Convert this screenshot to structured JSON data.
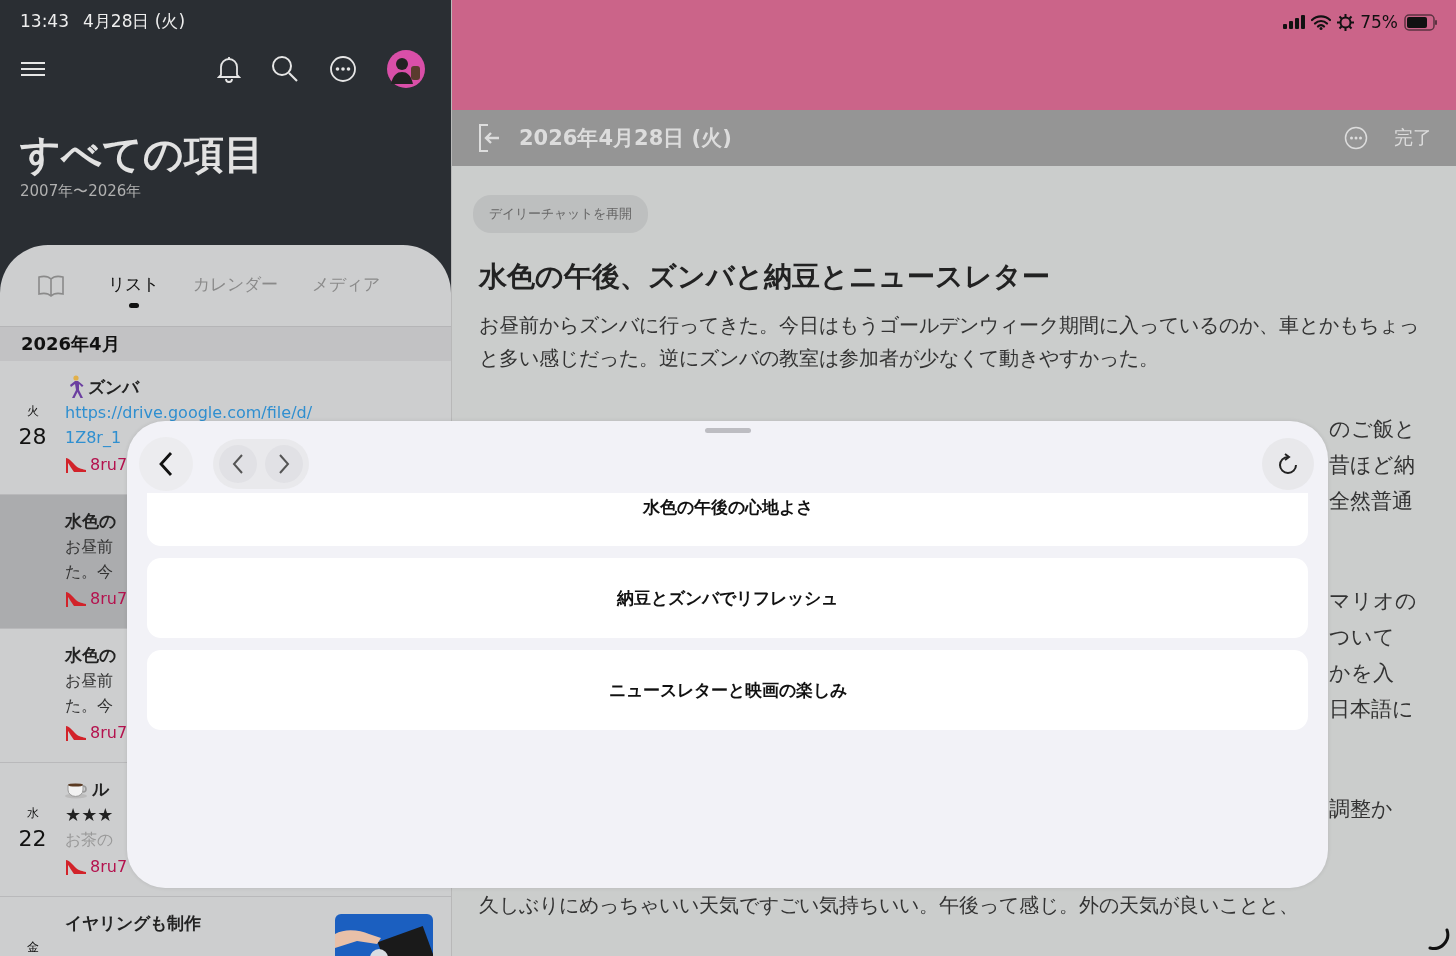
{
  "status_bar": {
    "time": "13:43",
    "date": "4月28日 (火)",
    "battery": "75%"
  },
  "sidebar": {
    "title": "すべての項目",
    "subtitle": "2007年〜2026年",
    "tabs": [
      {
        "label": "リスト",
        "selected": true
      },
      {
        "label": "カレンダー",
        "selected": false
      },
      {
        "label": "メディア",
        "selected": false
      }
    ],
    "month": "2026年4月",
    "entries": [
      {
        "weekday": "火",
        "day": "28",
        "selected": false,
        "title": "ズンバ",
        "lines": [
          {
            "kind": "link",
            "text": "https://drive.google.com/file/d/"
          },
          {
            "kind": "link",
            "text": "1Z8r_1"
          }
        ],
        "tag": "8ru7"
      },
      {
        "selected": true,
        "title": "水色の",
        "lines": [
          {
            "kind": "text",
            "text": "お昼前"
          },
          {
            "kind": "text",
            "text": "た。今"
          }
        ],
        "tag": "8ru7"
      },
      {
        "selected": false,
        "title": "水色の",
        "lines": [
          {
            "kind": "text",
            "text": "お昼前"
          },
          {
            "kind": "text",
            "text": "た。今"
          }
        ],
        "tag": "8ru7"
      },
      {
        "weekday": "水",
        "day": "22",
        "selected": false,
        "title": "ル",
        "lines": [
          {
            "kind": "stars",
            "text": "★★★"
          },
          {
            "kind": "muted",
            "text": "お茶の"
          }
        ],
        "tag": "8ru7"
      },
      {
        "weekday": "金",
        "selected": false,
        "title": "イヤリングも制作"
      }
    ]
  },
  "detail": {
    "date": "2026年4月28日 (火)",
    "done": "完了",
    "chip": "デイリーチャットを再開",
    "title": "水色の午後、ズンバと納豆とニュースレター",
    "paragraph": "お昼前からズンバに行ってきた。今日はもうゴールデンウィーク期間に入っているのか、車とかもちょっと多い感じだった。逆にズンバの教室は参加者が少なくて動きやすかった。",
    "partly_covered_lines": [
      [
        "のご飯と",
        "昔ほど納",
        "全然普通"
      ],
      [
        "マリオの",
        "ついて",
        "かを入",
        "日本語に"
      ],
      [
        "調整か"
      ]
    ],
    "last_paragraph": "久しぶりにめっちゃいい天気ですごい気持ちいい。午後って感じ。外の天気が良いことと、"
  },
  "sheet": {
    "options": [
      "水色の午後の心地よさ",
      "納豆とズンバでリフレッシュ",
      "ニュースレターと映画の楽しみ"
    ]
  }
}
